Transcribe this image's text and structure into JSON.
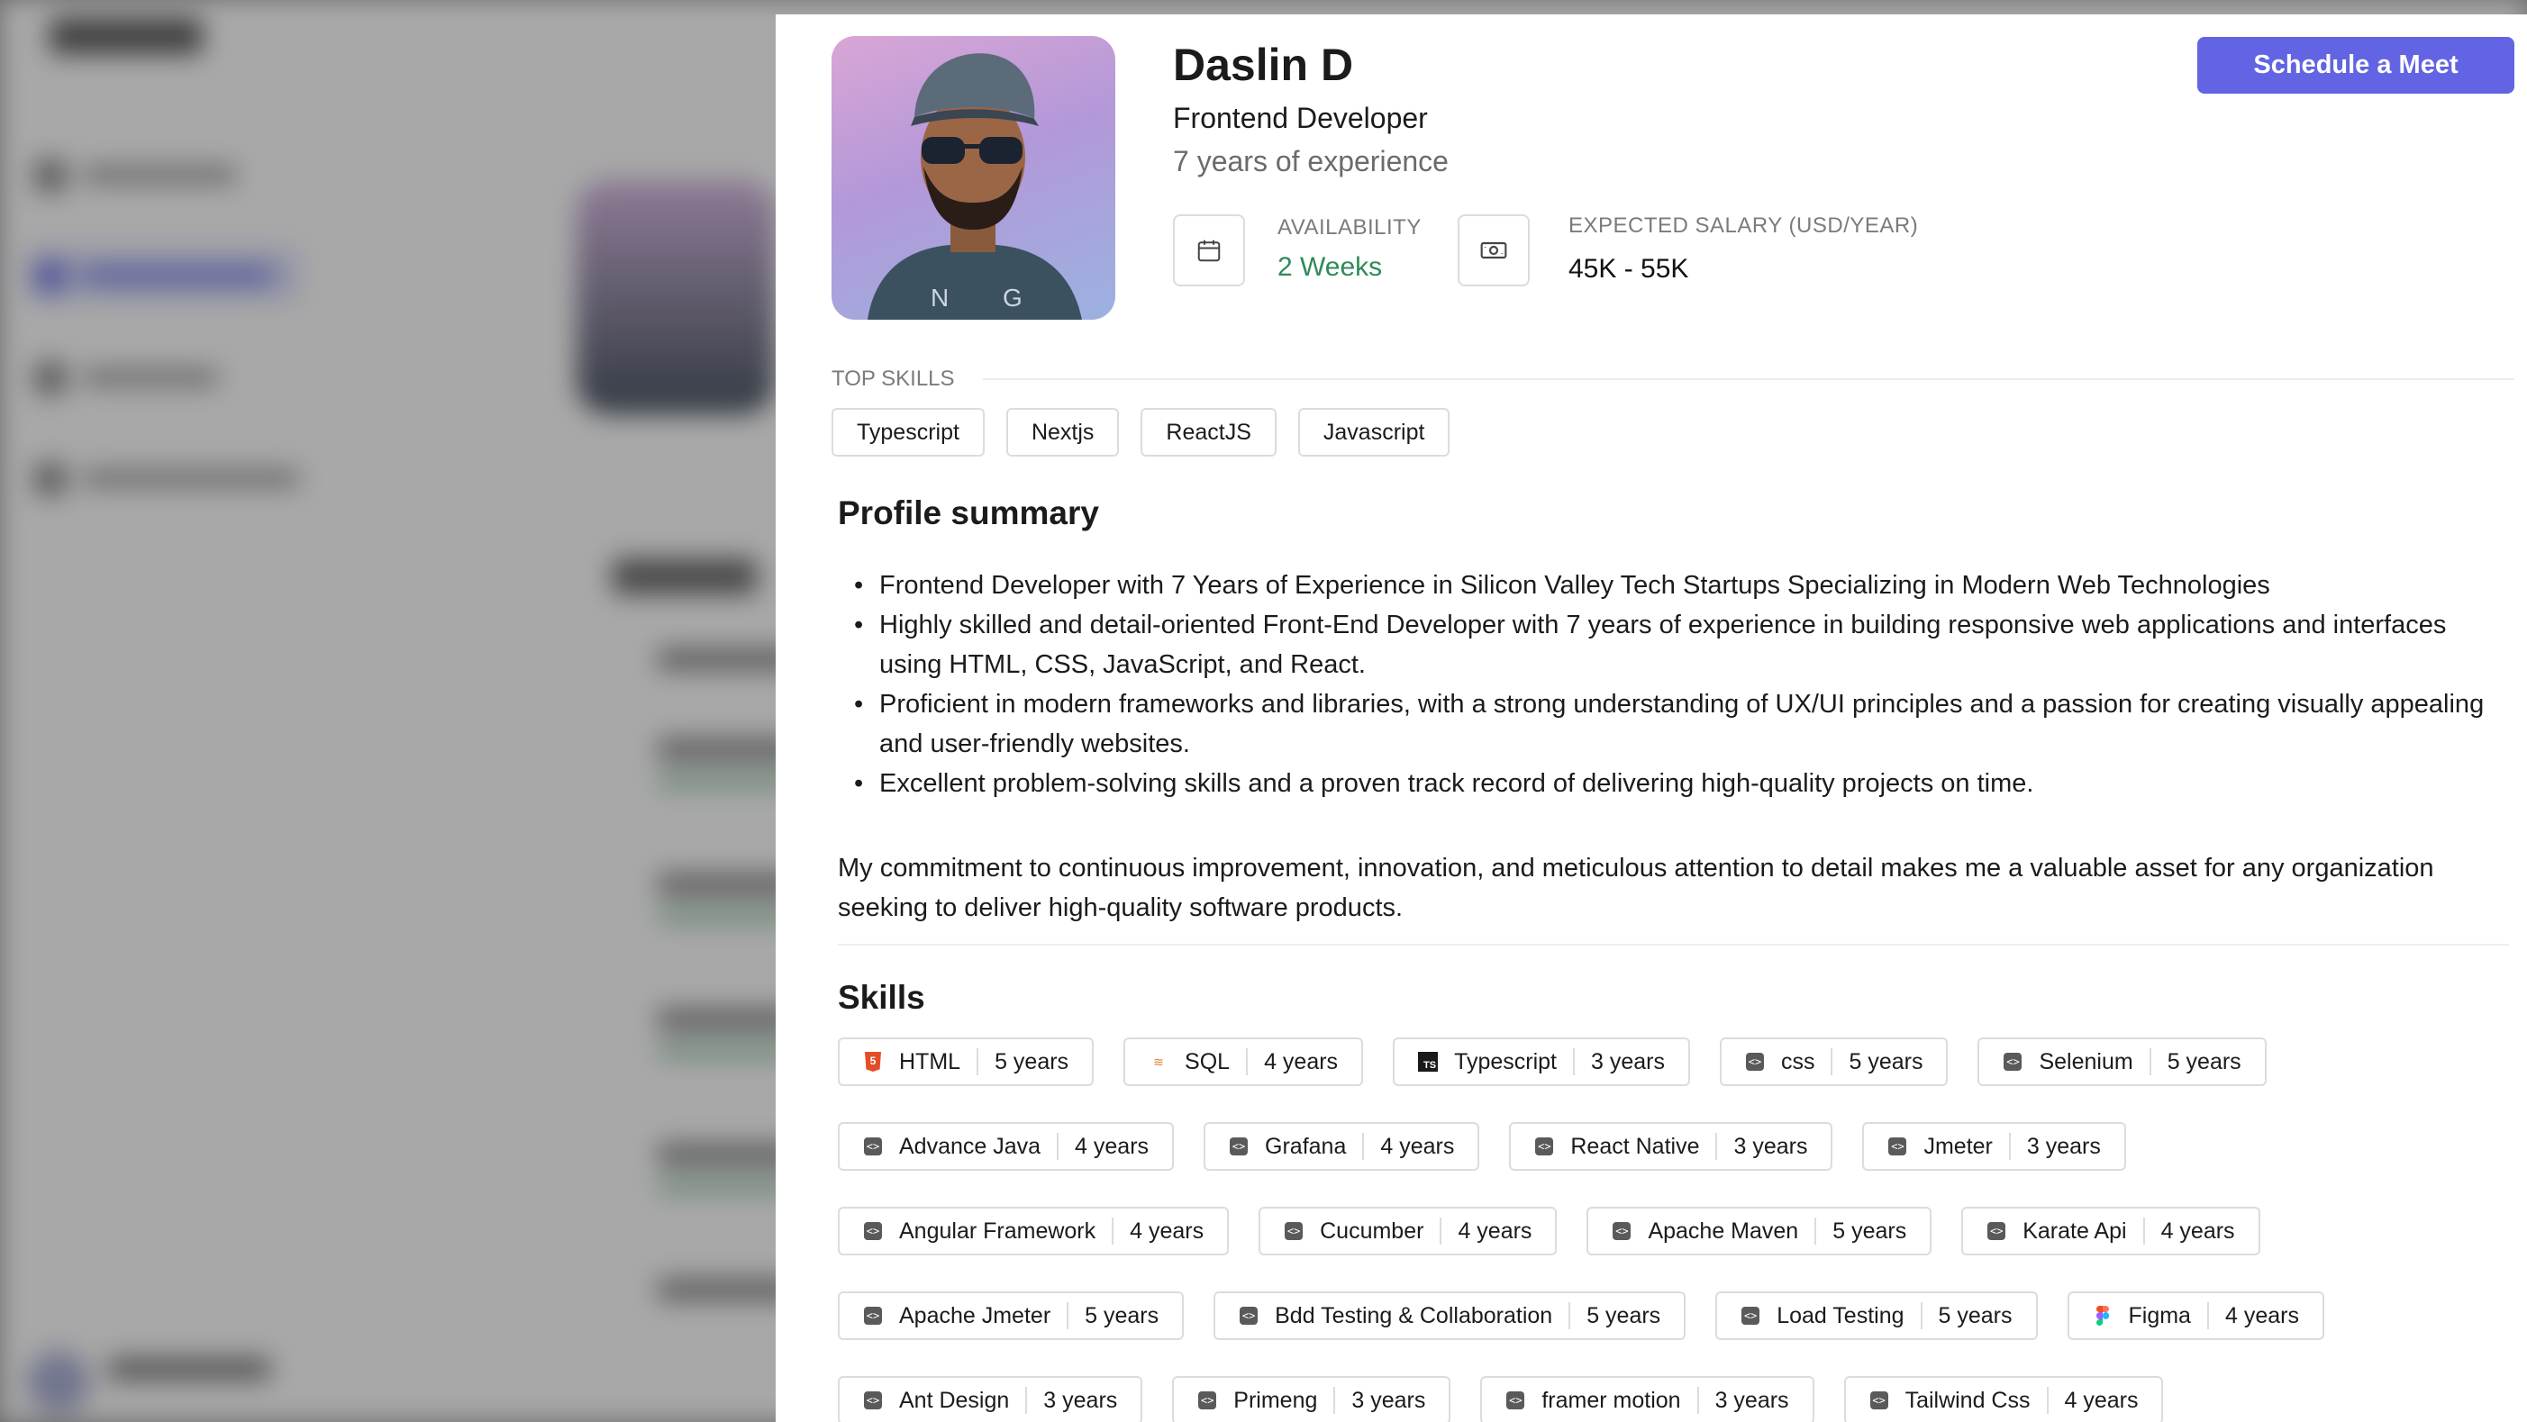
{
  "profile": {
    "name": "Daslin D",
    "role": "Frontend Developer",
    "experience": "7 years of experience",
    "availability_label": "AVAILABILITY",
    "availability_value": "2 Weeks",
    "salary_label": "EXPECTED SALARY (USD/YEAR)",
    "salary_value": "45K - 55K"
  },
  "actions": {
    "schedule_label": "Schedule a Meet"
  },
  "top_skills": {
    "label": "TOP SKILLS",
    "items": [
      "Typescript",
      "Nextjs",
      "ReactJS",
      "Javascript"
    ]
  },
  "summary": {
    "title": "Profile summary",
    "bullets": [
      "Frontend Developer with 7 Years of Experience in Silicon Valley Tech Startups Specializing in Modern Web Technologies",
      "Highly skilled and detail-oriented Front-End Developer with 7 years of experience in building responsive web applications and interfaces using HTML, CSS, JavaScript, and React.",
      "Proficient in modern frameworks and libraries, with a strong understanding of UX/UI principles and a passion for creating visually appealing and user-friendly websites.",
      "Excellent problem-solving skills and a proven track record of delivering high-quality projects on time."
    ],
    "paragraph": "My commitment to continuous improvement, innovation, and meticulous attention to detail makes me a valuable asset for any organization seeking to deliver high-quality software products."
  },
  "skills": {
    "title": "Skills",
    "rows": [
      [
        {
          "name": "HTML",
          "years": "5 years",
          "icon": "html5-icon"
        },
        {
          "name": "SQL",
          "years": "4 years",
          "icon": "sql-icon"
        },
        {
          "name": "Typescript",
          "years": "3 years",
          "icon": "typescript-icon"
        },
        {
          "name": "css",
          "years": "5 years",
          "icon": "code-icon"
        },
        {
          "name": "Selenium",
          "years": "5 years",
          "icon": "code-icon"
        }
      ],
      [
        {
          "name": "Advance Java",
          "years": "4 years",
          "icon": "code-icon"
        },
        {
          "name": "Grafana",
          "years": "4 years",
          "icon": "code-icon"
        },
        {
          "name": "React Native",
          "years": "3 years",
          "icon": "code-icon"
        },
        {
          "name": "Jmeter",
          "years": "3 years",
          "icon": "code-icon"
        }
      ],
      [
        {
          "name": "Angular Framework",
          "years": "4 years",
          "icon": "code-icon"
        },
        {
          "name": "Cucumber",
          "years": "4 years",
          "icon": "code-icon"
        },
        {
          "name": "Apache Maven",
          "years": "5 years",
          "icon": "code-icon"
        },
        {
          "name": "Karate Api",
          "years": "4 years",
          "icon": "code-icon"
        }
      ],
      [
        {
          "name": "Apache Jmeter",
          "years": "5 years",
          "icon": "code-icon"
        },
        {
          "name": "Bdd Testing & Collaboration",
          "years": "5 years",
          "icon": "code-icon"
        },
        {
          "name": "Load Testing",
          "years": "5 years",
          "icon": "code-icon"
        },
        {
          "name": "Figma",
          "years": "4 years",
          "icon": "figma-icon"
        }
      ],
      [
        {
          "name": "Ant Design",
          "years": "3 years",
          "icon": "code-icon"
        },
        {
          "name": "Primeng",
          "years": "3 years",
          "icon": "code-icon"
        },
        {
          "name": "framer motion",
          "years": "3 years",
          "icon": "code-icon"
        },
        {
          "name": "Tailwind Css",
          "years": "4 years",
          "icon": "code-icon"
        }
      ]
    ]
  },
  "colors": {
    "accent": "#6264e3",
    "availability": "#2f8a59"
  }
}
